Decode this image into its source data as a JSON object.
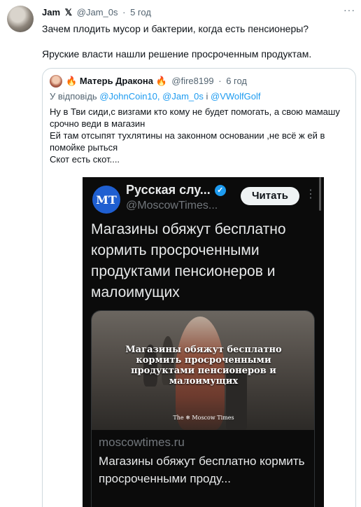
{
  "tweet": {
    "author_name": "Jam",
    "x_symbol": "𝕏",
    "handle": "@Jam_0s",
    "separator": "·",
    "time": "5 год",
    "more": "···",
    "text_line1": "Зачем плодить мусор и бактерии, когда есть пенсионеры?",
    "text_line2": "Яруские власти нашли решение просроченным продуктам."
  },
  "quote": {
    "author_fire_left": "🔥",
    "author_name": "Матерь Дракона",
    "author_fire_right": "🔥",
    "handle": "@fire8199",
    "separator": "·",
    "time": "6 год",
    "reply_prefix": "У відповідь",
    "reply_user1": "@JohnCoin10,",
    "reply_user2": "@Jam_0s",
    "reply_and": "і",
    "reply_user3": "@VWolfGolf",
    "text_lines": [
      "Ну в Тви сиди,с визгами кто кому не  будет помогать, а свою мамашу срочно веди в магазин",
      "Ей там отсыпят тухлятины на законном основании ,не всё ж ей в помойке рыться",
      "Скот есть скот...."
    ]
  },
  "embed": {
    "logo_text": "MT",
    "account_name": "Русская слу...",
    "verified_symbol": "✓",
    "account_handle": "@MoscowTimes...",
    "follow_label": "Читать",
    "more": "⋮",
    "headline": "Магазины обяжут бесплатно кормить просроченными продуктами пенсионеров и малоимущих",
    "image_overlay_text": "Магазины обяжут бесплатно кормить просроченными продуктами пенсионеров и малоимущих",
    "image_brand": "The ❄ Moscow Times",
    "card_domain": "moscowtimes.ru",
    "card_title": "Магазины обяжут бесплатно кормить просроченными проду..."
  },
  "colors": {
    "accent": "#1d9bf0",
    "secondary_text": "#536471",
    "embed_background": "#0b0b0b",
    "mt_brand": "#1f5fd1"
  }
}
